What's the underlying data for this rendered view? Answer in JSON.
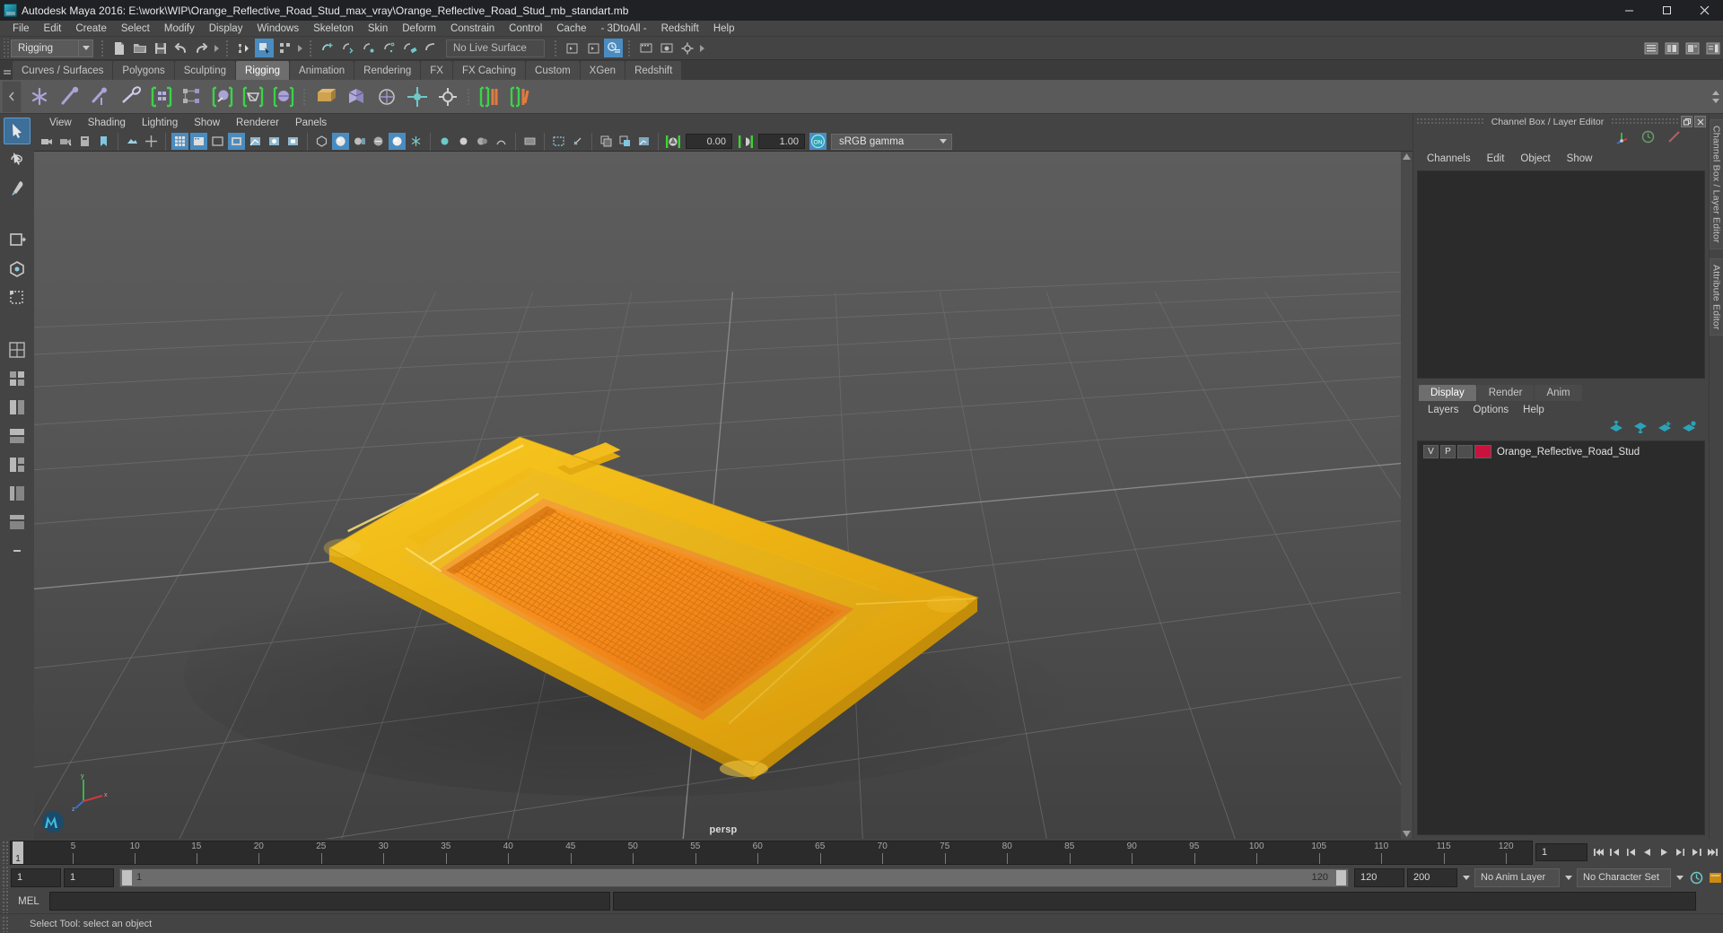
{
  "window": {
    "title": "Autodesk Maya 2016: E:\\work\\WIP\\Orange_Reflective_Road_Stud_max_vray\\Orange_Reflective_Road_Stud_mb_standart.mb",
    "icon": "maya-app-icon",
    "buttons": {
      "minimize": "minimize-icon",
      "maximize": "maximize-icon",
      "close": "close-icon"
    }
  },
  "menubar": {
    "items": [
      {
        "label": "File"
      },
      {
        "label": "Edit"
      },
      {
        "label": "Create"
      },
      {
        "label": "Select"
      },
      {
        "label": "Modify"
      },
      {
        "label": "Display"
      },
      {
        "label": "Windows"
      },
      {
        "label": "Skeleton"
      },
      {
        "label": "Skin"
      },
      {
        "label": "Deform"
      },
      {
        "label": "Constrain"
      },
      {
        "label": "Control"
      },
      {
        "label": "Cache"
      },
      {
        "label": "- 3DtoAll -"
      },
      {
        "label": "Redshift"
      },
      {
        "label": "Help"
      }
    ]
  },
  "statusbar": {
    "menuset": "Rigging",
    "live_surface": "No Live Surface",
    "icons": [
      "new-scene-icon",
      "open-scene-icon",
      "save-scene-icon",
      "undo-icon",
      "redo-icon",
      "select-by-hierarchy-icon",
      "select-by-object-icon",
      "select-by-component-icon",
      "snap-to-grid-icon",
      "snap-to-curve-icon",
      "snap-to-point-icon",
      "snap-to-projected-center-icon",
      "snap-to-view-plane-icon",
      "make-live-icon",
      "show-hide-editor-icon",
      "show-hide-attribute-icon",
      "construction-history-icon",
      "render-current-frame-icon",
      "ipr-render-icon",
      "render-settings-icon",
      "open-outliner-icon",
      "open-attribute-editor-icon",
      "open-tool-settings-icon",
      "open-channel-box-icon"
    ]
  },
  "shelf": {
    "tabs": [
      {
        "label": "Curves / Surfaces",
        "active": false
      },
      {
        "label": "Polygons",
        "active": false
      },
      {
        "label": "Sculpting",
        "active": false
      },
      {
        "label": "Rigging",
        "active": true
      },
      {
        "label": "Animation",
        "active": false
      },
      {
        "label": "Rendering",
        "active": false
      },
      {
        "label": "FX",
        "active": false
      },
      {
        "label": "FX Caching",
        "active": false
      },
      {
        "label": "Custom",
        "active": false
      },
      {
        "label": "XGen",
        "active": false
      },
      {
        "label": "Redshift",
        "active": false
      }
    ],
    "icons": [
      "create-joint-icon",
      "create-ik-handle-icon",
      "create-ik-spline-handle-icon",
      "insert-joint-icon",
      "bind-skin-icon",
      "interactive-bind-icon",
      "paint-skin-weights-icon",
      "mirror-skin-weights-icon",
      "create-lattice-icon",
      "create-cluster-icon",
      "create-nonlinear-bend-icon",
      "create-wrap-icon",
      "parent-constraint-icon",
      "point-constraint-icon",
      "orient-constraint-icon",
      "scale-constraint-icon",
      "create-deformer-set-icon",
      "edit-membership-icon"
    ]
  },
  "toolbox": {
    "tools": [
      {
        "name": "select-tool",
        "active": true
      },
      {
        "name": "lasso-select-tool",
        "active": false
      },
      {
        "name": "paint-select-tool",
        "active": false
      },
      {
        "name": "move-tool",
        "active": false
      },
      {
        "name": "rotate-tool",
        "active": false
      },
      {
        "name": "scale-tool",
        "active": false
      },
      {
        "name": "last-tool-used",
        "active": false
      }
    ],
    "layouts": [
      {
        "name": "single-perspective-layout"
      },
      {
        "name": "four-view-layout"
      },
      {
        "name": "two-pane-side-layout"
      },
      {
        "name": "two-pane-stacked-layout"
      },
      {
        "name": "three-pane-layout"
      },
      {
        "name": "outliner-persp-layout"
      },
      {
        "name": "hypergraph-layout"
      },
      {
        "name": "minimize-layout"
      }
    ]
  },
  "viewport": {
    "menus": [
      {
        "label": "View"
      },
      {
        "label": "Shading"
      },
      {
        "label": "Lighting"
      },
      {
        "label": "Show"
      },
      {
        "label": "Renderer"
      },
      {
        "label": "Panels"
      }
    ],
    "exposure_value": "0.00",
    "gamma_value": "1.00",
    "color_management": "sRGB gamma",
    "color_management_toggle": "ON",
    "camera_label": "persp",
    "toolbar_icons": [
      "select-camera-icon",
      "lock-camera-icon",
      "camera-attributes-icon",
      "bookmark-icon",
      "image-plane-icon",
      "two-d-pan-zoom-icon",
      "grid-toggle-icon",
      "film-gate-icon",
      "resolution-gate-icon",
      "gate-mask-icon",
      "xray-icon",
      "xray-joints-icon",
      "xray-active-components-icon",
      "wireframe-icon",
      "smooth-shade-all-icon",
      "flat-shade-icon",
      "hardware-texturing-icon",
      "use-default-lighting-icon",
      "shadows-icon",
      "ambient-occlusion-icon",
      "motion-blur-icon",
      "multisample-anti-aliasing-icon",
      "depth-of-field-icon",
      "isolate-select-icon",
      "object-display-icon",
      "manipulator-icon",
      "single-perspective-icon",
      "exposure-icon",
      "gamma-icon",
      "color-management-icon"
    ]
  },
  "channelbox_panel": {
    "title": "Channel Box / Layer Editor",
    "window_buttons": [
      "undock-icon",
      "close-icon"
    ],
    "quick_icons": [
      "show-manipulators-icon",
      "clock-icon",
      "no-entry-icon"
    ],
    "menus": [
      {
        "label": "Channels"
      },
      {
        "label": "Edit"
      },
      {
        "label": "Object"
      },
      {
        "label": "Show"
      }
    ]
  },
  "layer_editor": {
    "tabs": [
      {
        "label": "Display",
        "active": true
      },
      {
        "label": "Render",
        "active": false
      },
      {
        "label": "Anim",
        "active": false
      }
    ],
    "menus": [
      {
        "label": "Layers"
      },
      {
        "label": "Options"
      },
      {
        "label": "Help"
      }
    ],
    "tool_icons": [
      "move-layer-up-icon",
      "move-layer-down-icon",
      "new-layer-icon",
      "new-layer-from-selected-icon"
    ],
    "layers": [
      {
        "visibility": "V",
        "playback": "P",
        "type": "",
        "color": "#c9133e",
        "name": "Orange_Reflective_Road_Stud"
      }
    ]
  },
  "vertical_tabs": [
    {
      "label": "Channel Box / Layer Editor"
    },
    {
      "label": "Attribute Editor"
    }
  ],
  "timeline": {
    "start_frame": "1",
    "current_frame": "1",
    "ticks": [
      5,
      10,
      15,
      20,
      25,
      30,
      35,
      40,
      45,
      50,
      55,
      60,
      65,
      70,
      75,
      80,
      85,
      90,
      95,
      100,
      105,
      110,
      115,
      120
    ],
    "frame_field": "1",
    "playback_buttons": [
      "go-to-start-icon",
      "step-back-frame-icon",
      "step-back-key-icon",
      "play-backwards-icon",
      "play-forwards-icon",
      "step-forward-key-icon",
      "step-forward-frame-icon",
      "go-to-end-icon"
    ]
  },
  "range": {
    "anim_start": "1",
    "range_start": "1",
    "slider_min_label": "1",
    "slider_max_label": "120",
    "range_end": "120",
    "anim_end": "200",
    "anim_layer": "No Anim Layer",
    "character_set": "No Character Set",
    "right_icons": [
      "animation-preferences-icon",
      "auto-keyframe-icon"
    ]
  },
  "command_line": {
    "language_label": "MEL",
    "input_value": "",
    "output_value": ""
  },
  "status_line": {
    "text": "Select Tool: select an object"
  },
  "colors": {
    "accent_blue": "#4a8cc0",
    "shelf_highlight": "#6e6e6e",
    "layer_red": "#c9133e",
    "toggle_teal": "#2aa3b8",
    "model_yellow": "#e8b21b",
    "model_orange": "#f08a1c"
  }
}
